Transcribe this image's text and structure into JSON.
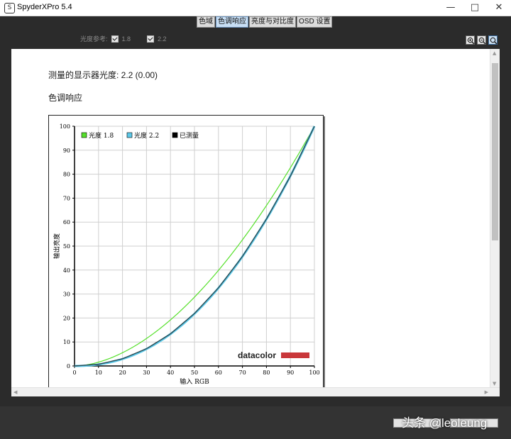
{
  "window": {
    "title": "SpyderXPro 5.4",
    "app_icon": "S",
    "minimize_icon": "minimize-icon",
    "maximize_icon": "maximize-icon",
    "close_icon": "close-icon"
  },
  "tabs": [
    {
      "label": "色域",
      "active": false
    },
    {
      "label": "色调响应",
      "active": true
    },
    {
      "label": "亮度与对比度",
      "active": false
    },
    {
      "label": "OSD 设置",
      "active": false
    }
  ],
  "gamma_reference": {
    "label": "光度参考:",
    "options": [
      {
        "value": "1.8",
        "checked": true
      },
      {
        "value": "2.2",
        "checked": true
      }
    ]
  },
  "zoom_icons": [
    "zoom-in-icon",
    "zoom-out-icon",
    "zoom-fit-icon"
  ],
  "report": {
    "measured_gamma": "测量的显示器光度: 2.2 (0.00)",
    "section_title": "色调响应"
  },
  "chart_data": {
    "type": "line",
    "xlabel": "输入 RGB",
    "ylabel": "输出亮度",
    "xlim": [
      0,
      100
    ],
    "ylim": [
      0,
      100
    ],
    "xticks": [
      0,
      10,
      20,
      30,
      40,
      50,
      60,
      70,
      80,
      90,
      100
    ],
    "yticks": [
      0,
      10,
      20,
      30,
      40,
      50,
      60,
      70,
      80,
      90,
      100
    ],
    "grid": true,
    "legend_position": "top-left",
    "watermark": "datacolor",
    "series": [
      {
        "name": "光度 1.8",
        "color": "#55e02a",
        "gamma": 1.8,
        "x": [
          0,
          10,
          20,
          30,
          40,
          50,
          60,
          70,
          80,
          90,
          100
        ],
        "y": [
          0,
          1.6,
          5.5,
          11.5,
          19.2,
          28.7,
          39.8,
          52.6,
          66.9,
          82.7,
          100
        ]
      },
      {
        "name": "光度 2.2",
        "color": "#5cc8e8",
        "gamma": 2.2,
        "x": [
          0,
          10,
          20,
          30,
          40,
          50,
          60,
          70,
          80,
          90,
          100
        ],
        "y": [
          0,
          0.6,
          2.9,
          7.1,
          13.3,
          21.8,
          32.5,
          45.6,
          61.2,
          79.3,
          100
        ]
      },
      {
        "name": "已测量",
        "color": "#000000",
        "x": [
          0,
          10,
          20,
          30,
          40,
          50,
          60,
          70,
          80,
          90,
          100
        ],
        "y": [
          0,
          0.7,
          3.0,
          7.2,
          13.4,
          21.9,
          32.6,
          45.7,
          61.3,
          79.2,
          100
        ]
      }
    ]
  },
  "watermark": "头条 @leoleung"
}
